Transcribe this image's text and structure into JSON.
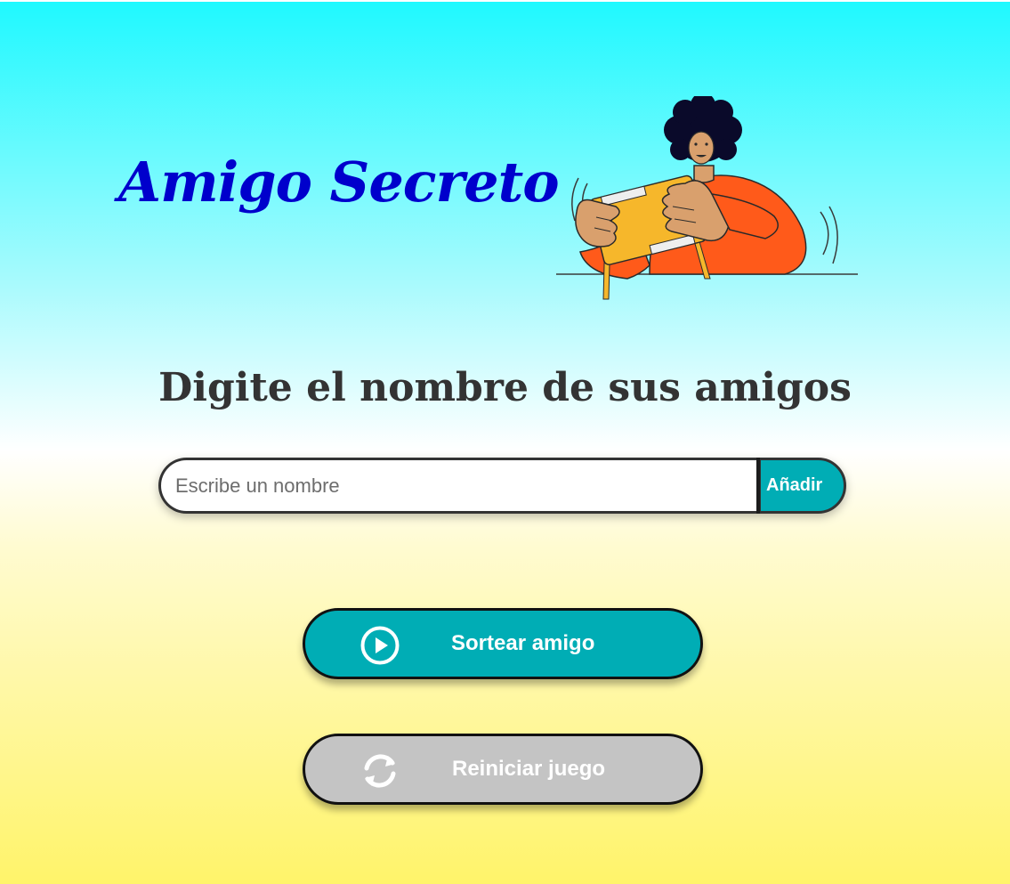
{
  "header": {
    "title": "Amigo Secreto",
    "illustration_icon": "person-with-game-console-icon"
  },
  "main": {
    "subtitle": "Digite el nombre de sus amigos",
    "name_input": {
      "value": "",
      "placeholder": "Escribe un nombre"
    },
    "add_button_label": "Añadir",
    "draw_button": {
      "label": "Sortear amigo",
      "icon": "play-circle-icon"
    },
    "reset_button": {
      "label": "Reiniciar juego",
      "icon": "refresh-icon"
    }
  },
  "colors": {
    "title": "#0000cc",
    "subtitle": "#333333",
    "accent": "#00adb5",
    "disabled": "#c4c4c4",
    "gradient_top": "#1ef9ff",
    "gradient_bottom": "#fff46a"
  }
}
